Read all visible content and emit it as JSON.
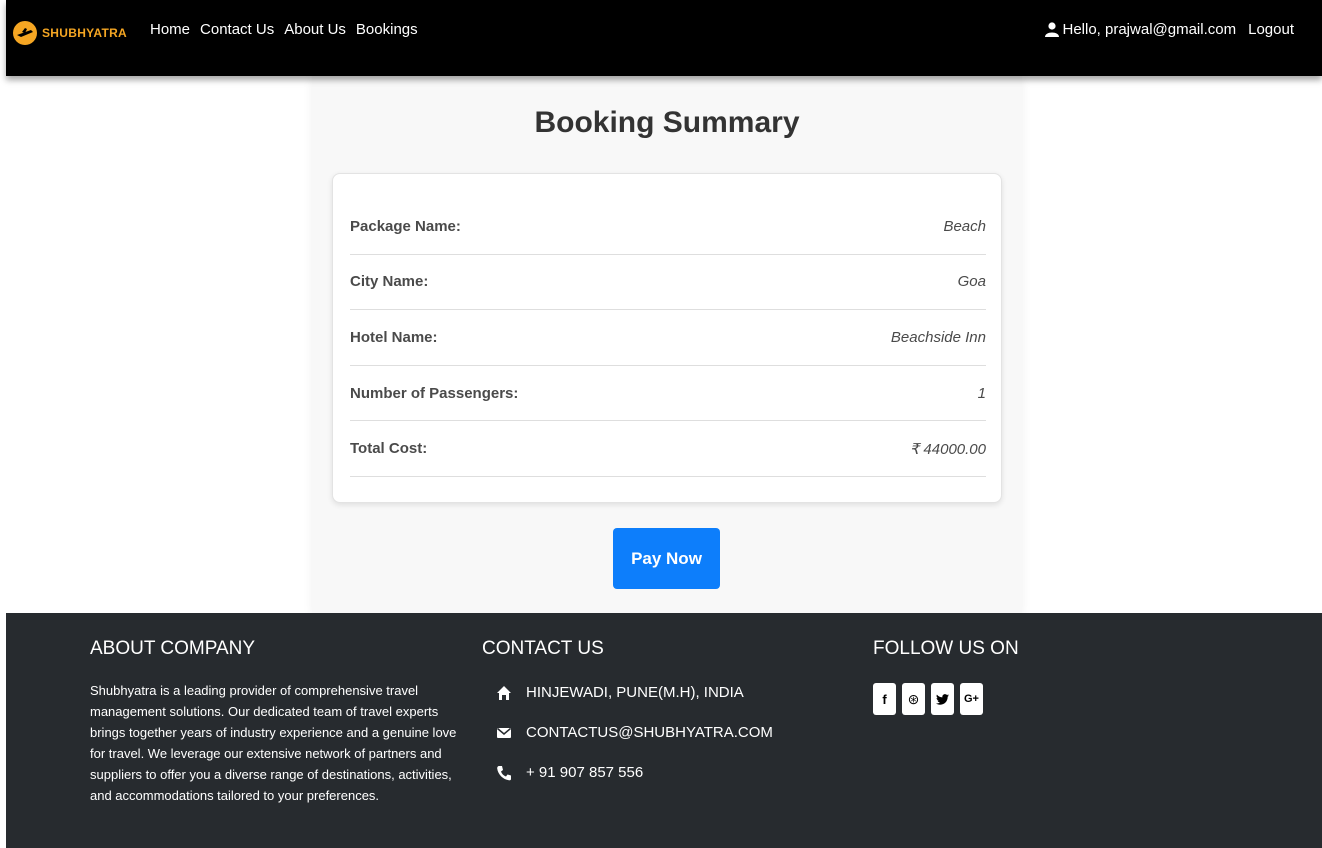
{
  "nav": {
    "brand": "SHUBHYATRA",
    "links": [
      "Home",
      "Contact Us",
      "About Us",
      "Bookings"
    ],
    "user_greeting": "Hello, prajwal@gmail.com",
    "logout": "Logout"
  },
  "summary": {
    "title": "Booking Summary",
    "rows": [
      {
        "label": "Package Name:",
        "value": "Beach"
      },
      {
        "label": "City Name:",
        "value": "Goa"
      },
      {
        "label": "Hotel Name:",
        "value": "Beachside Inn"
      },
      {
        "label": "Number of Passengers:",
        "value": "1"
      },
      {
        "label": "Total Cost:",
        "value": "₹ 44000.00"
      }
    ],
    "pay_button": "Pay Now"
  },
  "footer": {
    "about_heading": "ABOUT COMPANY",
    "about_text": "Shubhyatra is a leading provider of comprehensive travel management solutions. Our dedicated team of travel experts brings together years of industry experience and a genuine love for travel. We leverage our extensive network of partners and suppliers to offer you a diverse range of destinations, activities, and accommodations tailored to your preferences.",
    "contact_heading": "CONTACT US",
    "contact_items": [
      {
        "icon": "home-icon",
        "text": "HINJEWADI, PUNE(M.H), INDIA"
      },
      {
        "icon": "envelope-icon",
        "text": "CONTACTUS@SHUBHYATRA.COM"
      },
      {
        "icon": "phone-icon",
        "text": "+ 91 907 857 556"
      }
    ],
    "follow_heading": "FOLLOW US ON",
    "social": [
      {
        "icon": "facebook-icon",
        "glyph": "f"
      },
      {
        "icon": "dribbble-icon",
        "glyph": "⊛"
      },
      {
        "icon": "twitter-icon",
        "glyph": "🐦"
      },
      {
        "icon": "google-plus-icon",
        "glyph": "G+"
      }
    ]
  },
  "colors": {
    "brand_accent": "#f5a623",
    "primary_button": "#0d7efb",
    "navbar_bg": "#000000",
    "footer_bg": "#272b2f"
  }
}
